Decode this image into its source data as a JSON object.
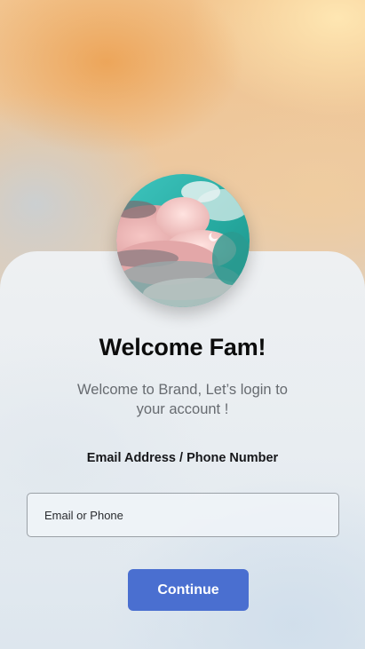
{
  "welcome": {
    "title": "Welcome Fam!",
    "subtitle": "Welcome to Brand, Let’s login to your account !"
  },
  "login": {
    "field_label": "Email Address / Phone Number",
    "input_placeholder": "Email or Phone",
    "input_value": "",
    "continue_label": "Continue"
  },
  "colors": {
    "accent": "#4a6fd0",
    "title": "#0c0c0c",
    "subtitle": "#676b70"
  }
}
